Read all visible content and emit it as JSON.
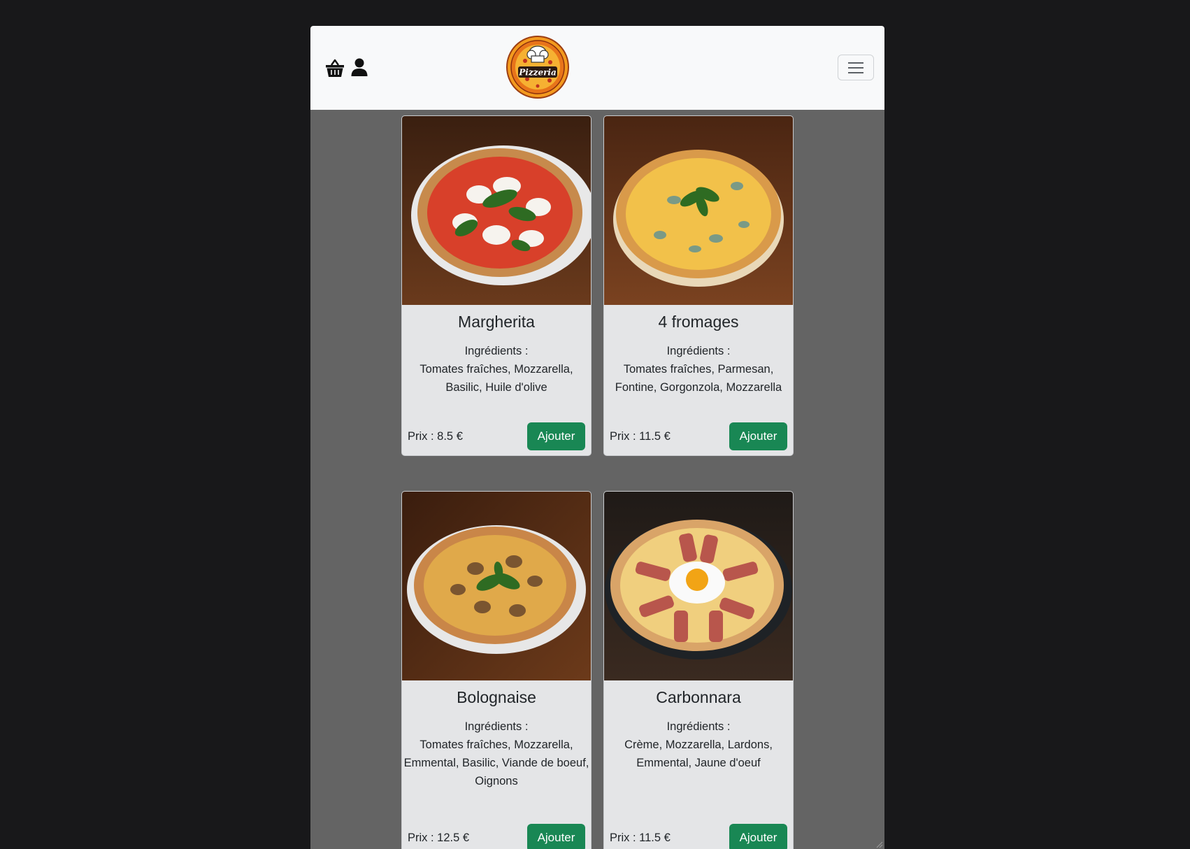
{
  "header": {
    "basket_icon": "basket-icon",
    "user_icon": "user-icon",
    "logo_text": "Pizzeria",
    "menu_icon": "hamburger-menu-icon"
  },
  "colors": {
    "page_bg": "#18181a",
    "content_bg": "#646464",
    "navbar_bg": "#f8f9fa",
    "card_bg": "#e4e5e7",
    "button_green": "#198754",
    "logo_orange": "#f39a1e"
  },
  "pizzas": [
    {
      "name": "Margherita",
      "ingredients_label": "Ingrédients :",
      "ingredients": "Tomates fraîches, Mozzarella, Basilic, Huile d'olive",
      "price": "Prix : 8.5 €",
      "button": "Ajouter"
    },
    {
      "name": "4 fromages",
      "ingredients_label": "Ingrédients :",
      "ingredients": "Tomates fraîches, Parmesan, Fontine, Gorgonzola, Mozzarella",
      "price": "Prix : 11.5 €",
      "button": "Ajouter"
    },
    {
      "name": "Bolognaise",
      "ingredients_label": "Ingrédients :",
      "ingredients": "Tomates fraîches, Mozzarella, Emmental, Basilic, Viande de boeuf, Oignons",
      "price": "Prix : 12.5 €",
      "button": "Ajouter"
    },
    {
      "name": "Carbonnara",
      "ingredients_label": "Ingrédients :",
      "ingredients": "Crème, Mozzarella, Lardons, Emmental, Jaune d'oeuf",
      "price": "Prix : 11.5 €",
      "button": "Ajouter"
    }
  ]
}
